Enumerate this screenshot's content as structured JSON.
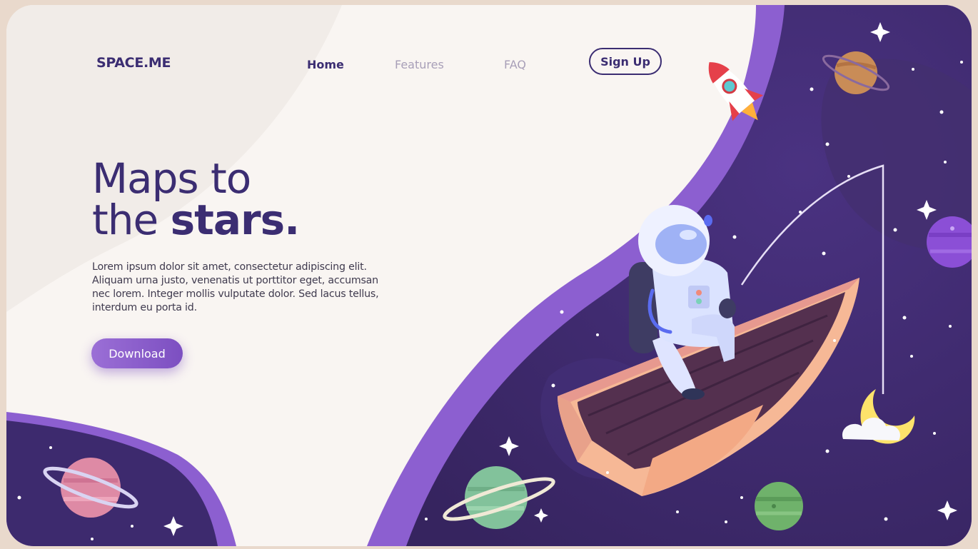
{
  "brand": {
    "logo": "SPACE.ME"
  },
  "nav": {
    "links": [
      {
        "label": "Home",
        "active": true
      },
      {
        "label": "Features",
        "active": false
      },
      {
        "label": "FAQ",
        "active": false
      }
    ],
    "signup_label": "Sign Up"
  },
  "hero": {
    "title_line1": "Maps to",
    "title_line2_a": "the ",
    "title_line2_b": "stars.",
    "body": "Lorem ipsum dolor sit amet, consectetur adipiscing elit. Aliquam urna justo, venenatis ut porttitor eget, accumsan nec lorem. Integer mollis vulputate dolor. Sed lacus tellus, interdum eu porta id.",
    "download_label": "Download"
  },
  "colors": {
    "brand_dark": "#3b2d72",
    "space_purple": "#3d2a6e",
    "accent_purple": "#8c5fd0",
    "page_bg": "#f9f5f2",
    "outer_bg": "#e9d9cc"
  },
  "illustration": {
    "icons": [
      "rocket-icon",
      "astronaut-icon",
      "boat-icon",
      "moon-icon",
      "cloud-icon",
      "planet-icon",
      "star-icon",
      "fishing-rod-icon"
    ]
  }
}
